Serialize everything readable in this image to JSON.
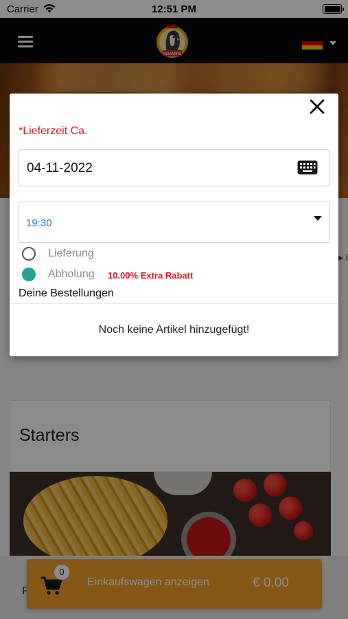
{
  "status_bar": {
    "carrier": "Carrier",
    "time": "12:51 PM"
  },
  "header": {
    "logo_text": "ISHAN'S",
    "language_flag": "germany-flag-icon",
    "menu_icon": "hamburger-menu-icon"
  },
  "modal": {
    "delivery_time_label": "*Lieferzeit Ca.",
    "date_value": "04-11-2022",
    "time_value": "19:30",
    "delivery_option": "Lieferung",
    "pickup_option": "Abholung",
    "pickup_discount": "10.00% Extra Rabatt",
    "selected_option": "Abholung",
    "orders_title": "Deine Bestellungen",
    "empty_message": "Noch keine Artikel hinzugefügt!"
  },
  "menu": {
    "category_title": "Starters",
    "product_initial": "P"
  },
  "cart": {
    "count": "0",
    "label": "Einkaufswagen anzeigen",
    "total": "€ 0,00"
  },
  "colors": {
    "header_bg": "#070707",
    "required_red": "#e0141e",
    "selected_radio": "#27a294",
    "time_blue": "#2275cc",
    "cart_orange": "#f2a12a"
  }
}
